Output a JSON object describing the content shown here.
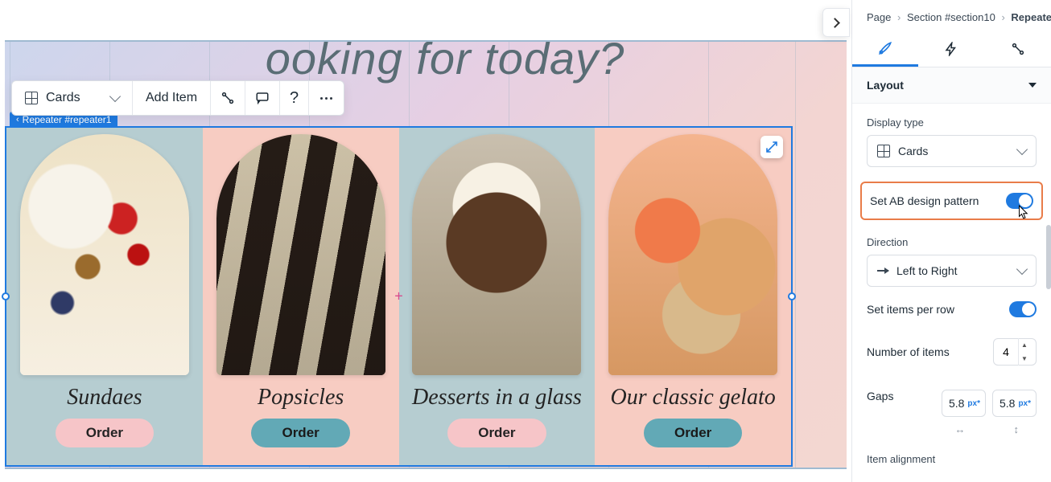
{
  "breadcrumb": {
    "page": "Page",
    "section": "Section #section10",
    "current": "Repeater"
  },
  "heading": "ooking for today?",
  "toolbar": {
    "display_label": "Cards",
    "add_item": "Add Item"
  },
  "repeater_chip": "Repeater #repeater1",
  "cards": [
    {
      "title": "Sundaes",
      "button": "Order",
      "variant": "a",
      "img": "img-sundae"
    },
    {
      "title": "Popsicles",
      "button": "Order",
      "variant": "b",
      "img": "img-pops"
    },
    {
      "title": "Desserts in a glass",
      "button": "Order",
      "variant": "a",
      "img": "img-glass"
    },
    {
      "title": "Our classic gelato",
      "button": "Order",
      "variant": "b",
      "img": "img-gelato"
    }
  ],
  "panel": {
    "section_title": "Layout",
    "display_type_label": "Display type",
    "display_type_value": "Cards",
    "ab_label": "Set AB design pattern",
    "direction_label": "Direction",
    "direction_value": "Left to Right",
    "items_per_row_label": "Set items per row",
    "number_items_label": "Number of items",
    "number_items_value": "4",
    "gaps_label": "Gaps",
    "gap_h": "5.8",
    "gap_v": "5.8",
    "gap_unit": "px*",
    "alignment_label": "Item alignment"
  }
}
